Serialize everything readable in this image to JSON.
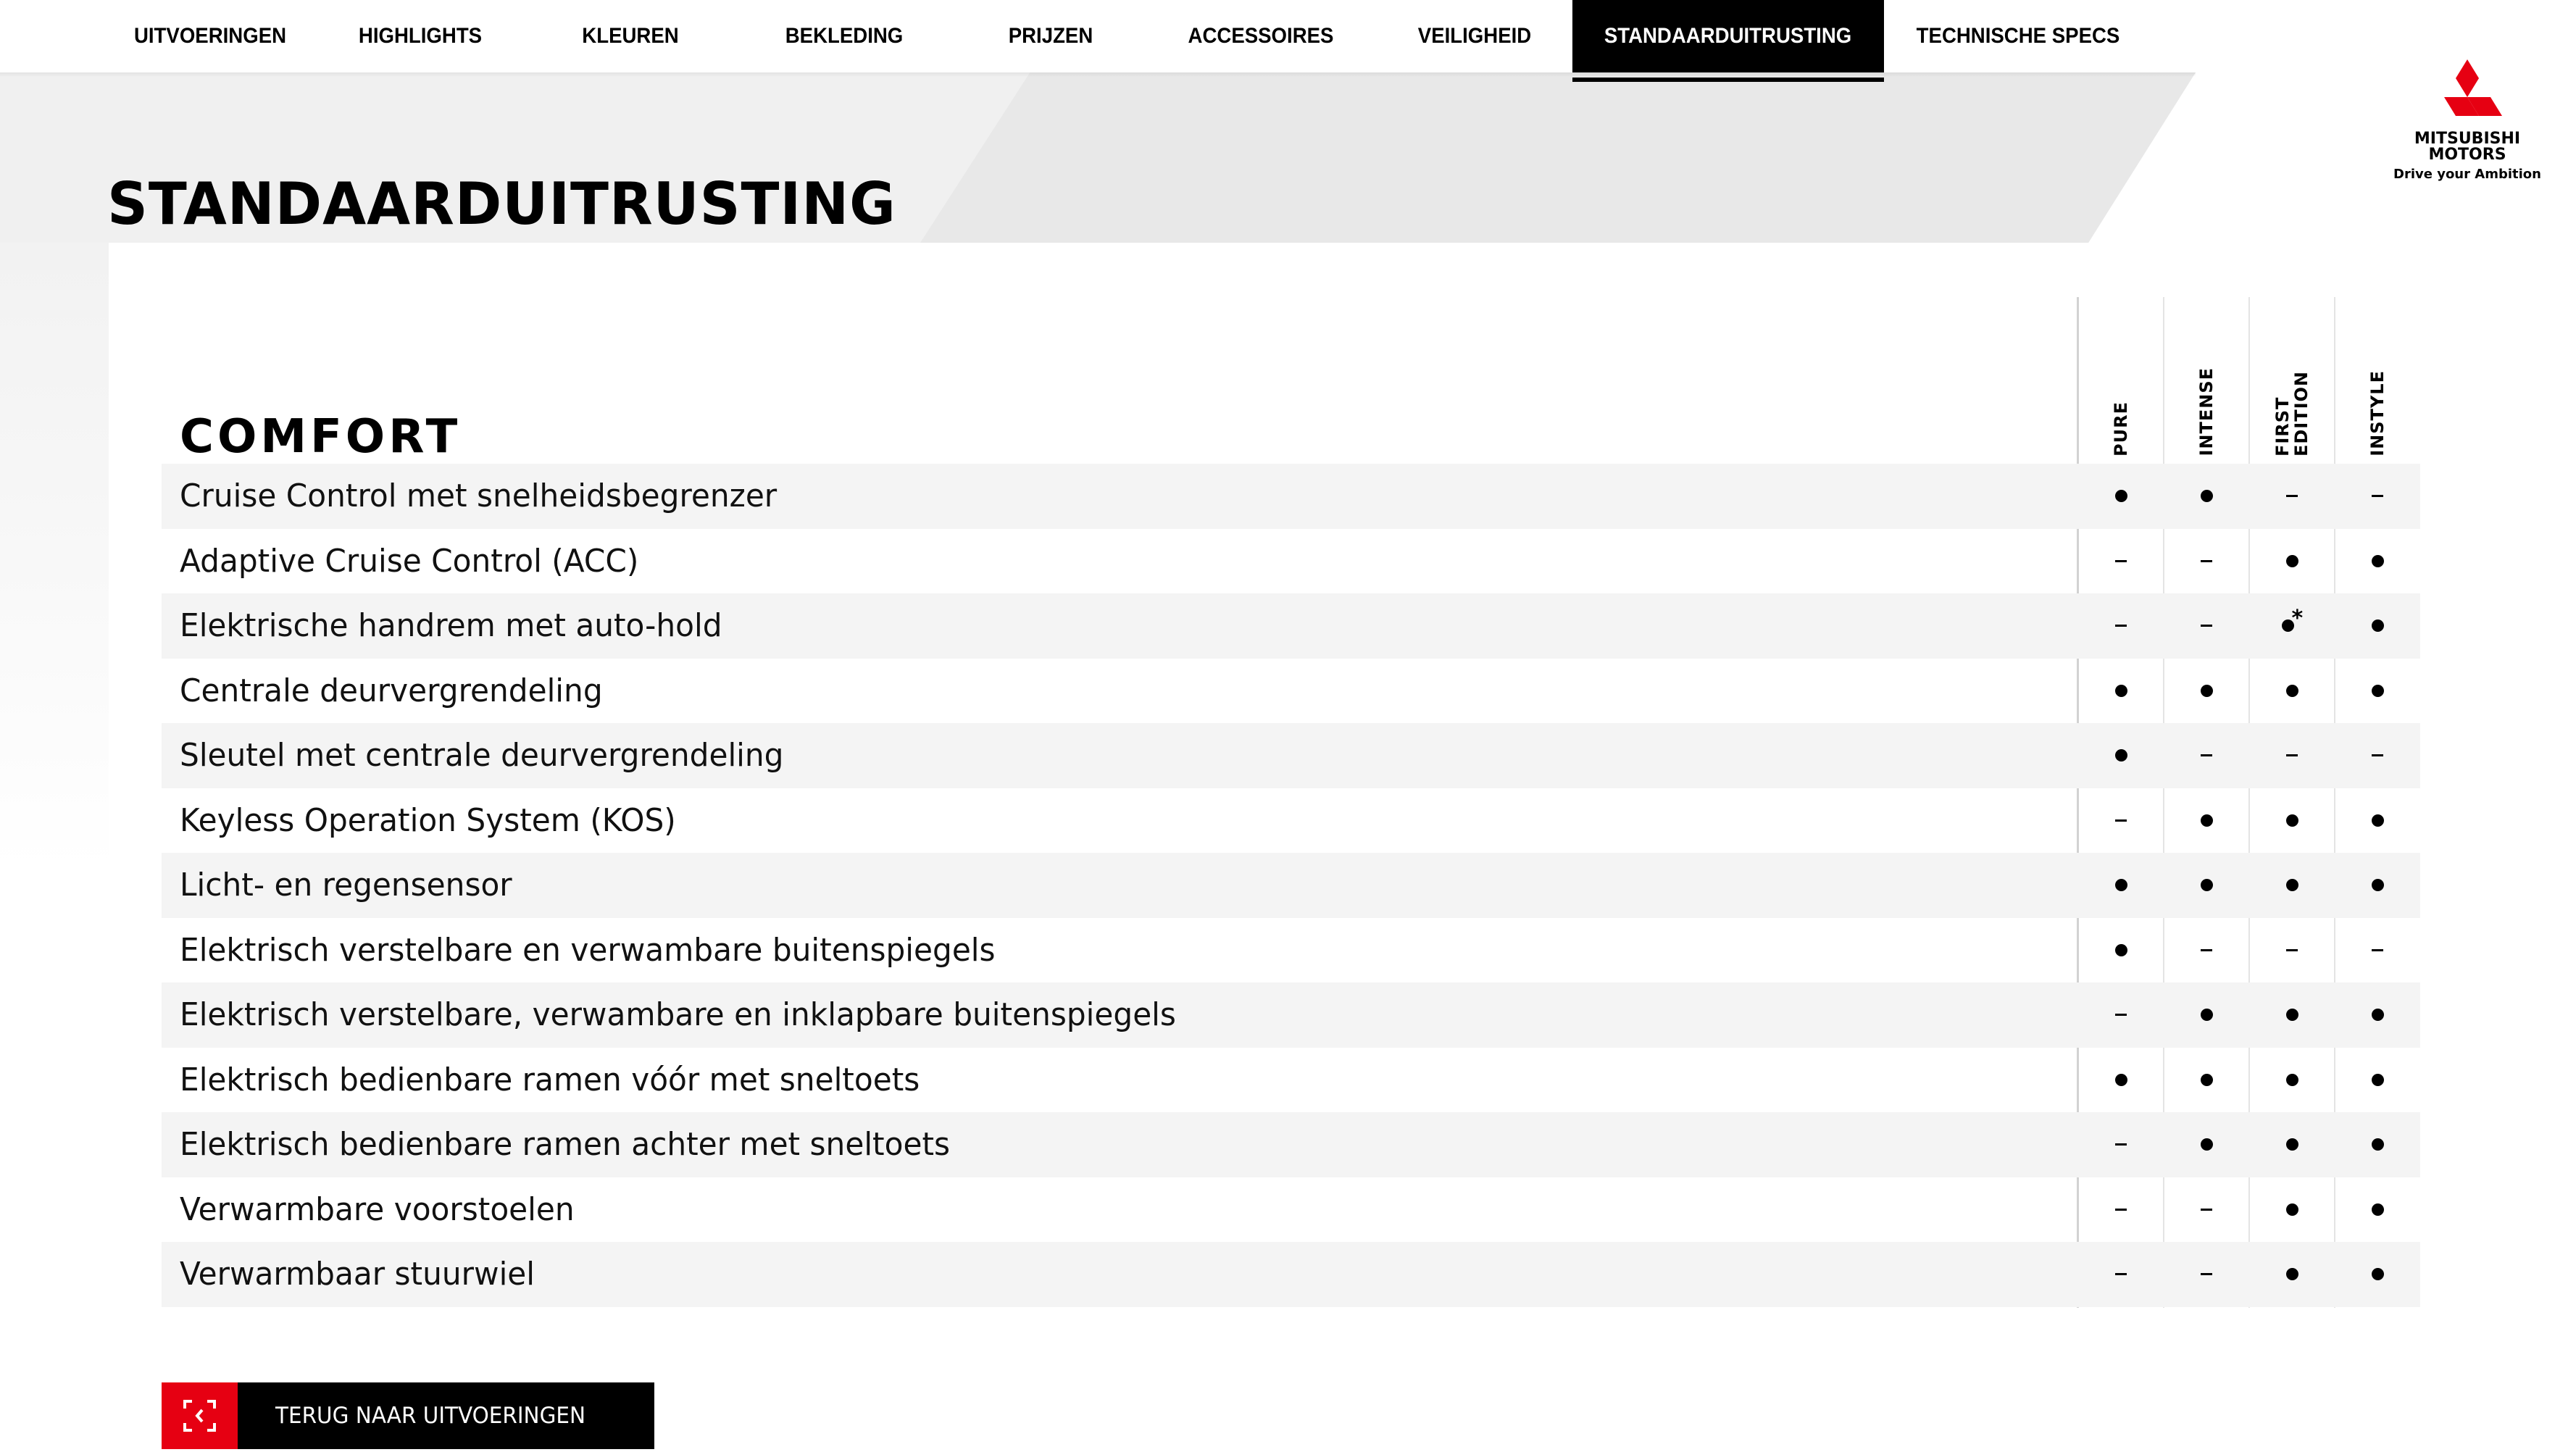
{
  "nav": {
    "items": [
      {
        "label": "UITVOERINGEN",
        "active": false
      },
      {
        "label": "HIGHLIGHTS",
        "active": false
      },
      {
        "label": "KLEUREN",
        "active": false
      },
      {
        "label": "BEKLEDING",
        "active": false
      },
      {
        "label": "PRIJZEN",
        "active": false
      },
      {
        "label": "ACCESSOIRES",
        "active": false
      },
      {
        "label": "VEILIGHEID",
        "active": false
      },
      {
        "label": "STANDAARDUITRUSTING",
        "active": true
      },
      {
        "label": "TECHNISCHE SPECS",
        "active": false
      }
    ]
  },
  "page_title": "STANDAARDUITRUSTING",
  "logo": {
    "icon": "mitsubishi-three-diamonds-icon",
    "line1": "MITSUBISHI",
    "line2": "MOTORS",
    "tagline": "Drive your Ambition",
    "color": "#e60012"
  },
  "section": {
    "title": "COMFORT",
    "columns": [
      "PURE",
      "INTENSE",
      "FIRST\nEDITION",
      "INSTYLE"
    ],
    "legend": {
      "standard": "●",
      "not_available": "–",
      "footnote_marker": "*"
    },
    "rows": [
      {
        "label": "Cruise Control met snelheidsbegrenzer",
        "values": [
          "●",
          "●",
          "–",
          "–"
        ]
      },
      {
        "label": "Adaptive Cruise Control (ACC)",
        "values": [
          "–",
          "–",
          "●",
          "●"
        ]
      },
      {
        "label": "Elektrische handrem met auto-hold",
        "values": [
          "–",
          "–",
          "●*",
          "●"
        ]
      },
      {
        "label": "Centrale deurvergrendeling",
        "values": [
          "●",
          "●",
          "●",
          "●"
        ]
      },
      {
        "label": "Sleutel met centrale deurvergrendeling",
        "values": [
          "●",
          "–",
          "–",
          "–"
        ]
      },
      {
        "label": "Keyless Operation System (KOS)",
        "values": [
          "–",
          "●",
          "●",
          "●"
        ]
      },
      {
        "label": "Licht- en regensensor",
        "values": [
          "●",
          "●",
          "●",
          "●"
        ]
      },
      {
        "label": "Elektrisch verstelbare en verwambare buitenspiegels",
        "values": [
          "●",
          "–",
          "–",
          "–"
        ]
      },
      {
        "label": "Elektrisch verstelbare, verwambare en inklapbare buitenspiegels",
        "values": [
          "–",
          "●",
          "●",
          "●"
        ]
      },
      {
        "label": "Elektrisch bedienbare ramen vóór met sneltoets",
        "values": [
          "●",
          "●",
          "●",
          "●"
        ]
      },
      {
        "label": "Elektrisch bedienbare ramen achter met sneltoets",
        "values": [
          "–",
          "●",
          "●",
          "●"
        ]
      },
      {
        "label": "Verwarmbare voorstoelen",
        "values": [
          "–",
          "–",
          "●",
          "●"
        ]
      },
      {
        "label": "Verwarmbaar stuurwiel",
        "values": [
          "–",
          "–",
          "●",
          "●"
        ]
      }
    ]
  },
  "back_button": {
    "label": "TERUG NAAR UITVOERINGEN",
    "icon": "back-chevron-frame-icon",
    "icon_bg": "#e60012"
  }
}
